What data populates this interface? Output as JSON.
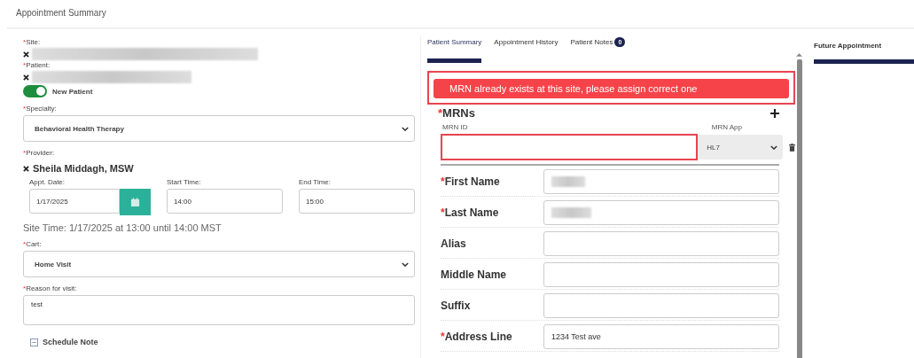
{
  "page_title": "Appointment Summary",
  "left": {
    "site": {
      "label": "Site:",
      "required_mark": "*",
      "redacted": true
    },
    "patient": {
      "label": "Patient:",
      "required_mark": "*",
      "redacted": true
    },
    "new_patient": {
      "label": "New Patient",
      "on": true
    },
    "specialty": {
      "label": "Specialty:",
      "required_mark": "*",
      "value": "Behavioral Health Therapy"
    },
    "provider": {
      "label": "Provider:",
      "required_mark": "*",
      "value": "Sheila Middagh, MSW"
    },
    "appt_date": {
      "label": "Appt. Date:",
      "value": "1/17/2025"
    },
    "start_time": {
      "label": "Start Time:",
      "value": "14:00"
    },
    "end_time": {
      "label": "End Time:",
      "value": "15:00"
    },
    "site_time": "Site Time: 1/17/2025 at 13:00 until 14:00 MST",
    "cart": {
      "label": "Cart:",
      "required_mark": "*",
      "value": "Home Visit"
    },
    "reason": {
      "label": "Reason for visit:",
      "required_mark": "*",
      "value": "test"
    },
    "schedule_note": {
      "label": "Schedule Note",
      "expanded": true
    }
  },
  "tabs": [
    {
      "label": "Patient Summary",
      "selected": true
    },
    {
      "label": "Appointment History",
      "selected": false
    },
    {
      "label": "Patient Notes",
      "selected": false,
      "badge": "0"
    }
  ],
  "alert": "MRN already exists at this site, please assign correct one",
  "mrns": {
    "title": "MRNs",
    "required_mark": "*",
    "id_label": "MRN ID",
    "app_label": "MRN App",
    "app_value": "HL7",
    "id_error": true
  },
  "fields": [
    {
      "label": "First Name",
      "required_mark": "*",
      "redacted": true
    },
    {
      "label": "Last Name",
      "required_mark": "*",
      "redacted": true
    },
    {
      "label": "Alias"
    },
    {
      "label": "Middle Name"
    },
    {
      "label": "Suffix"
    },
    {
      "label": "Address Line",
      "required_mark": "*",
      "value": "1234 Test ave"
    }
  ],
  "right": {
    "title": "Future Appointment"
  }
}
